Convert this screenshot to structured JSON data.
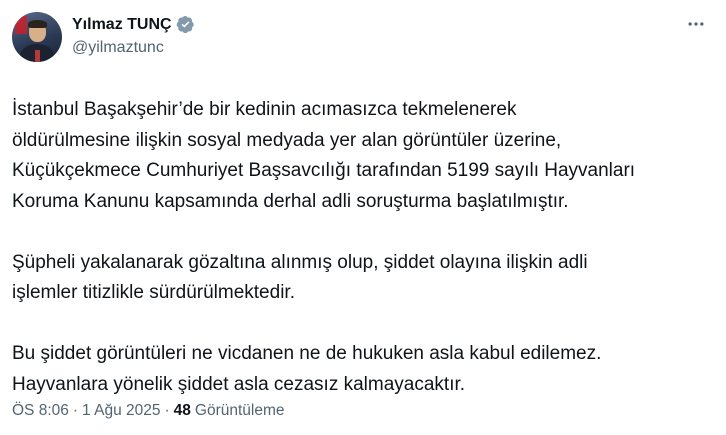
{
  "author": {
    "display_name": "Yılmaz TUNÇ",
    "handle": "@yilmaztunc",
    "verified": true,
    "verified_badge_color": "#829aab"
  },
  "more_icon": "ellipsis-icon",
  "tweet": {
    "lines_p1": [
      "İstanbul Başakşehir’de bir kedinin acımasızca tekmelenerek",
      "öldürülmesine ilişkin sosyal medyada yer alan görüntüler üzerine,",
      "Küçükçekmece Cumhuriyet Başsavcılığı tarafından 5199 sayılı Hayvanları",
      "Koruma Kanunu kapsamında derhal adli soruşturma başlatılmıştır."
    ],
    "lines_p2": [
      "Şüpheli yakalanarak gözaltına alınmış olup, şiddet olayına ilişkin adli",
      "işlemler titizlikle sürdürülmektedir."
    ],
    "lines_p3": [
      "Bu şiddet görüntüleri ne vicdanen ne de hukuken asla kabul edilemez.",
      "Hayvanlara yönelik şiddet asla cezasız kalmayacaktır."
    ]
  },
  "meta": {
    "time": "ÖS 8:06",
    "separator": "·",
    "date": "1 Ağu 2025",
    "views_count": "48",
    "views_label": "Görüntüleme"
  }
}
